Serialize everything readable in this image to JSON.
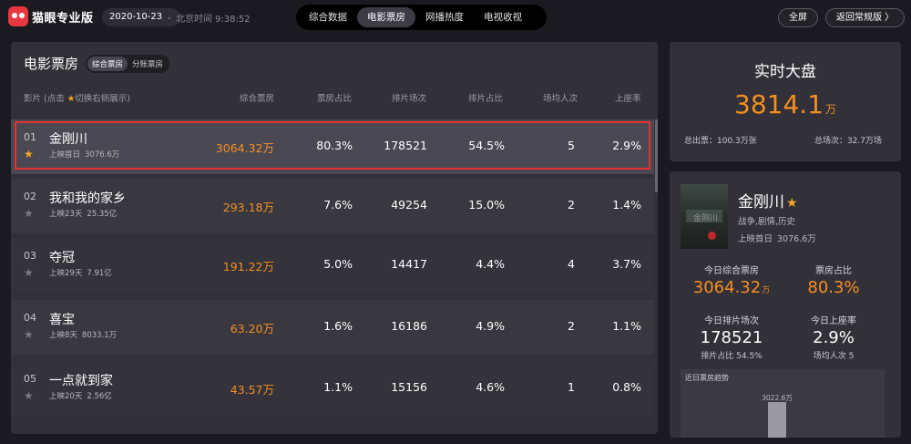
{
  "header": {
    "brand": "猫眼专业版",
    "date": "2020-10-23",
    "clock_label": "北京时间",
    "clock_time": "9:38:52",
    "tabs": [
      {
        "label": "综合数据",
        "active": false
      },
      {
        "label": "电影票房",
        "active": true
      },
      {
        "label": "网播热度",
        "active": false
      },
      {
        "label": "电视收视",
        "active": false
      }
    ],
    "fullscreen_label": "全屏",
    "back_label": "返回常规版 〉"
  },
  "colors": {
    "accent": "#f68e1e",
    "star": "#f6a623",
    "brand": "#e8383d",
    "highlight": "#e0322e"
  },
  "main": {
    "title": "电影票房",
    "subtabs": [
      {
        "label": "综合票房",
        "active": true
      },
      {
        "label": "分账票房",
        "active": false
      }
    ],
    "columns": {
      "film_prefix": "影片 (点击",
      "film_suffix": "切换右侧展示)",
      "box_office": "综合票房",
      "share": "票房占比",
      "shows": "排片场次",
      "show_share": "排片占比",
      "avg": "场均人次",
      "occupancy": "上座率"
    },
    "rows": [
      {
        "rank": "01",
        "starred": true,
        "name": "金刚川",
        "release": "上映首日",
        "total": "3076.6万",
        "box": "3064.32万",
        "share": "80.3%",
        "shows": "178521",
        "show_share": "54.5%",
        "avg": "5",
        "occupancy": "2.9%"
      },
      {
        "rank": "02",
        "starred": false,
        "name": "我和我的家乡",
        "release": "上映23天",
        "total": "25.35亿",
        "box": "293.18万",
        "share": "7.6%",
        "shows": "49254",
        "show_share": "15.0%",
        "avg": "2",
        "occupancy": "1.4%"
      },
      {
        "rank": "03",
        "starred": false,
        "name": "夺冠",
        "release": "上映29天",
        "total": "7.91亿",
        "box": "191.22万",
        "share": "5.0%",
        "shows": "14417",
        "show_share": "4.4%",
        "avg": "4",
        "occupancy": "3.7%"
      },
      {
        "rank": "04",
        "starred": false,
        "name": "喜宝",
        "release": "上映8天",
        "total": "8033.1万",
        "box": "63.20万",
        "share": "1.6%",
        "shows": "16186",
        "show_share": "4.9%",
        "avg": "2",
        "occupancy": "1.1%"
      },
      {
        "rank": "05",
        "starred": false,
        "name": "一点就到家",
        "release": "上映20天",
        "total": "2.56亿",
        "box": "43.57万",
        "share": "1.1%",
        "shows": "15156",
        "show_share": "4.6%",
        "avg": "1",
        "occupancy": "0.8%"
      }
    ]
  },
  "realtime": {
    "title": "实时大盘",
    "value": "3814.1",
    "unit": "万",
    "total_tickets": "总出票：100.3万张",
    "total_shows": "总场次：32.7万场"
  },
  "detail": {
    "poster_text": "金刚川",
    "name": "金刚川",
    "genre": "战争,剧情,历史",
    "release": "上映首日",
    "total": "3076.6万",
    "today_box_label": "今日综合票房",
    "today_box_value": "3064.32",
    "today_box_unit": "万",
    "share_label": "票房占比",
    "share_value": "80.3%",
    "shows_label": "今日排片场次",
    "shows_value": "178521",
    "show_share": "排片占比 54.5%",
    "occupancy_label": "今日上座率",
    "occupancy_value": "2.9%",
    "avg": "场均人次 5",
    "trend_title": "近日票房趋势",
    "trend_value_label": "3022.6万",
    "trend_level": 0.55
  }
}
